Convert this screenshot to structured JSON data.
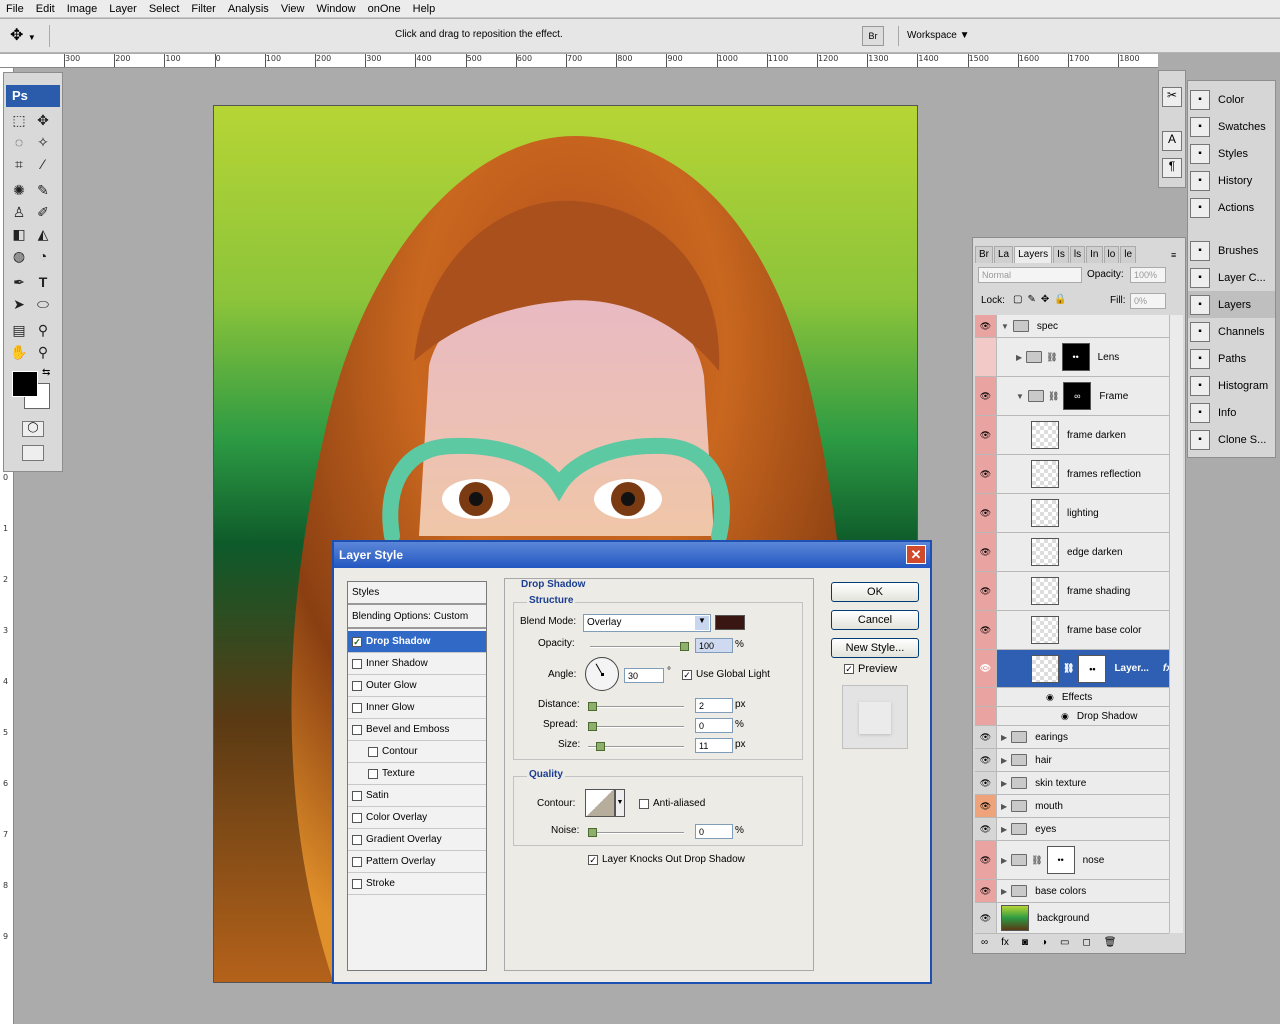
{
  "menu": [
    "File",
    "Edit",
    "Image",
    "Layer",
    "Select",
    "Filter",
    "Analysis",
    "View",
    "Window",
    "onOne",
    "Help"
  ],
  "options": {
    "hint": "Click and drag to reposition the effect.",
    "workspace": "Workspace"
  },
  "ruler": {
    "top": [
      "300",
      "200",
      "100",
      "0",
      "100",
      "200",
      "300",
      "400",
      "500",
      "600",
      "700",
      "800",
      "900",
      "1000",
      "1100",
      "1200",
      "1300",
      "1400",
      "1500",
      "1600",
      "1700",
      "1800"
    ],
    "left": [
      "0",
      "1",
      "2",
      "3",
      "4",
      "5",
      "6",
      "7",
      "8",
      "9"
    ]
  },
  "toolbox": {
    "logo": "Ps"
  },
  "dialog": {
    "title": "Layer Style",
    "close": "✕",
    "styles_header": "Styles",
    "blending": "Blending Options: Custom",
    "items": [
      {
        "label": "Drop Shadow",
        "checked": true,
        "selected": true,
        "indent": false
      },
      {
        "label": "Inner Shadow",
        "checked": false,
        "indent": false
      },
      {
        "label": "Outer Glow",
        "checked": false,
        "indent": false
      },
      {
        "label": "Inner Glow",
        "checked": false,
        "indent": false
      },
      {
        "label": "Bevel and Emboss",
        "checked": false,
        "indent": false
      },
      {
        "label": "Contour",
        "checked": false,
        "indent": true
      },
      {
        "label": "Texture",
        "checked": false,
        "indent": true
      },
      {
        "label": "Satin",
        "checked": false,
        "indent": false
      },
      {
        "label": "Color Overlay",
        "checked": false,
        "indent": false
      },
      {
        "label": "Gradient Overlay",
        "checked": false,
        "indent": false
      },
      {
        "label": "Pattern Overlay",
        "checked": false,
        "indent": false
      },
      {
        "label": "Stroke",
        "checked": false,
        "indent": false
      }
    ],
    "section_title": "Drop Shadow",
    "structure": "Structure",
    "blend_mode_label": "Blend Mode:",
    "blend_mode": "Overlay",
    "shadow_color": "#3a1612",
    "opacity_label": "Opacity:",
    "opacity": "100",
    "pct": "%",
    "angle_label": "Angle:",
    "angle": "30",
    "deg": "°",
    "global_light": "Use Global Light",
    "distance_label": "Distance:",
    "distance": "2",
    "spread_label": "Spread:",
    "spread": "0",
    "size_label": "Size:",
    "size": "11",
    "px": "px",
    "quality": "Quality",
    "contour_label": "Contour:",
    "anti_aliased": "Anti-aliased",
    "noise_label": "Noise:",
    "noise": "0",
    "knockout": "Layer Knocks Out Drop Shadow",
    "ok": "OK",
    "cancel": "Cancel",
    "new_style": "New Style...",
    "preview": "Preview"
  },
  "panels_top": [
    {
      "label": "Color",
      "icon": "color-icon"
    },
    {
      "label": "Swatches",
      "icon": "swatches-icon"
    },
    {
      "label": "Styles",
      "icon": "styles-icon"
    },
    {
      "label": "History",
      "icon": "history-icon"
    },
    {
      "label": "Actions",
      "icon": "actions-icon"
    }
  ],
  "panels_bottom": [
    {
      "label": "Brushes",
      "icon": "brushes-icon"
    },
    {
      "label": "Layer C...",
      "icon": "layer-comps-icon"
    },
    {
      "label": "Layers",
      "icon": "layers-icon"
    },
    {
      "label": "Channels",
      "icon": "channels-icon"
    },
    {
      "label": "Paths",
      "icon": "paths-icon"
    },
    {
      "label": "Histogram",
      "icon": "histogram-icon"
    },
    {
      "label": "Info",
      "icon": "info-icon"
    },
    {
      "label": "Clone S...",
      "icon": "clone-source-icon"
    }
  ],
  "layers": {
    "tabs": [
      "Br",
      "La",
      "Layers",
      "Is",
      "ls",
      "In",
      "lo",
      "le"
    ],
    "blend": "Normal",
    "opacity_label": "Opacity:",
    "opacity": "100%",
    "lock_label": "Lock:",
    "fill_label": "Fill:",
    "fill": "0%",
    "rows": [
      {
        "name": "spec",
        "type": "group",
        "open": true,
        "level": 0,
        "eye": "pink"
      },
      {
        "name": "Lens",
        "type": "group",
        "open": false,
        "level": 1,
        "eye": "none",
        "mask": "dots"
      },
      {
        "name": "Frame",
        "type": "group",
        "open": true,
        "level": 1,
        "eye": "pink",
        "mask": "infinity"
      },
      {
        "name": "frame darken",
        "type": "layer",
        "level": 2,
        "eye": "pink"
      },
      {
        "name": "frames reflection",
        "type": "layer",
        "level": 2,
        "eye": "pink"
      },
      {
        "name": "lighting",
        "type": "layer",
        "level": 2,
        "eye": "pink"
      },
      {
        "name": "edge darken",
        "type": "layer",
        "level": 2,
        "eye": "pink"
      },
      {
        "name": "frame shading",
        "type": "layer",
        "level": 2,
        "eye": "pink"
      },
      {
        "name": "frame base color",
        "type": "layer",
        "level": 2,
        "eye": "pink"
      },
      {
        "name": "Layer...",
        "type": "selected",
        "level": 2,
        "eye": "pink"
      },
      {
        "name": "Effects",
        "type": "effect",
        "level": 3,
        "eye": "pink"
      },
      {
        "name": "Drop Shadow",
        "type": "effect",
        "level": 4,
        "eye": "pink"
      },
      {
        "name": "earings",
        "type": "group",
        "open": false,
        "level": 0,
        "eye": "gray"
      },
      {
        "name": "hair",
        "type": "group",
        "open": false,
        "level": 0,
        "eye": "gray"
      },
      {
        "name": "skin texture",
        "type": "group",
        "open": false,
        "level": 0,
        "eye": "gray"
      },
      {
        "name": "mouth",
        "type": "group",
        "open": false,
        "level": 0,
        "eye": "orange"
      },
      {
        "name": "eyes",
        "type": "group",
        "open": false,
        "level": 0,
        "eye": "gray"
      },
      {
        "name": "nose",
        "type": "group",
        "open": false,
        "level": 0,
        "eye": "pink",
        "mask": "dots2"
      },
      {
        "name": "base colors",
        "type": "group",
        "open": false,
        "level": 0,
        "eye": "pink"
      },
      {
        "name": "background",
        "type": "background",
        "level": 0,
        "eye": "gray"
      }
    ]
  }
}
